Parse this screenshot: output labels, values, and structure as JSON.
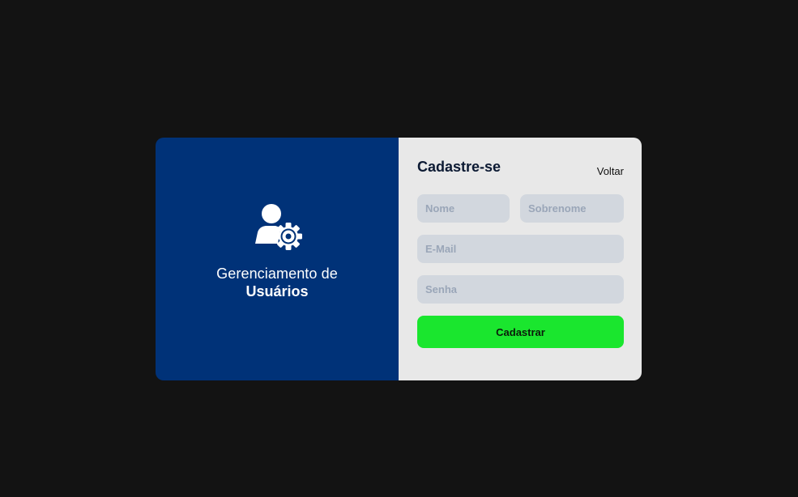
{
  "brand": {
    "icon": "user-gear-icon",
    "line1": "Gerenciamento de",
    "line2": "Usuários"
  },
  "form": {
    "title": "Cadastre-se",
    "back_label": "Voltar",
    "fields": {
      "first_name": {
        "placeholder": "Nome",
        "value": ""
      },
      "last_name": {
        "placeholder": "Sobrenome",
        "value": ""
      },
      "email": {
        "placeholder": "E-Mail",
        "value": ""
      },
      "password": {
        "placeholder": "Senha",
        "value": ""
      }
    },
    "submit_label": "Cadastrar"
  },
  "colors": {
    "background": "#131313",
    "brand_panel": "#003278",
    "form_panel": "#e8e8e8",
    "input_bg": "#d2d7de",
    "submit": "#1ae62e"
  }
}
